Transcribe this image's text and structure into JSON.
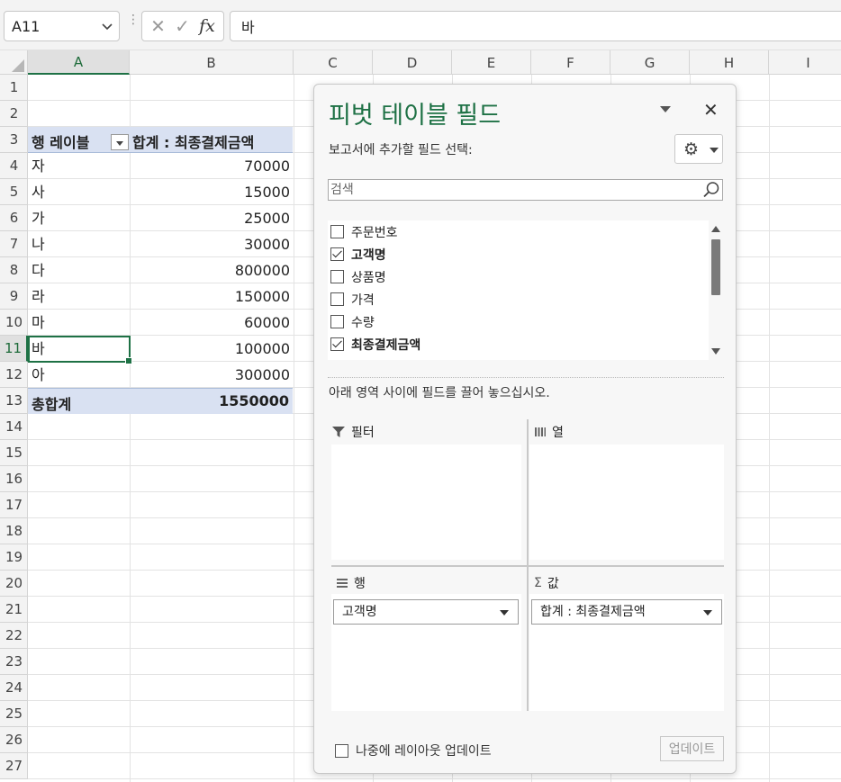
{
  "formula_bar": {
    "name_box": "A11",
    "formula_value": "바",
    "cancel_glyph": "✕",
    "enter_glyph": "✓",
    "fx_label": "fx"
  },
  "columns": [
    "A",
    "B",
    "C",
    "D",
    "E",
    "F",
    "G",
    "H",
    "I"
  ],
  "rows": [
    "1",
    "2",
    "3",
    "4",
    "5",
    "6",
    "7",
    "8",
    "9",
    "10",
    "11",
    "12",
    "13",
    "14",
    "15",
    "16",
    "17",
    "18",
    "19",
    "20",
    "21",
    "22",
    "23",
    "24",
    "25",
    "26",
    "27"
  ],
  "active_cell": {
    "column": "A",
    "row": "11"
  },
  "pivot_table": {
    "row_label_header": "행 레이블",
    "value_header": "합계 : 최종결제금액",
    "items": [
      {
        "label": "자",
        "value": "70000"
      },
      {
        "label": "사",
        "value": "15000"
      },
      {
        "label": "가",
        "value": "25000"
      },
      {
        "label": "나",
        "value": "30000"
      },
      {
        "label": "다",
        "value": "800000"
      },
      {
        "label": "라",
        "value": "150000"
      },
      {
        "label": "마",
        "value": "60000"
      },
      {
        "label": "바",
        "value": "100000"
      },
      {
        "label": "아",
        "value": "300000"
      }
    ],
    "grand_total_label": "총합계",
    "grand_total_value": "1550000"
  },
  "pane": {
    "title": "피벗 테이블 필드",
    "close_glyph": "✕",
    "choose_fields_label": "보고서에 추가할 필드 선택:",
    "gear_glyph": "⚙",
    "search_placeholder": "검색",
    "fields": [
      {
        "label": "주문번호",
        "checked": false
      },
      {
        "label": "고객명",
        "checked": true
      },
      {
        "label": "상품명",
        "checked": false
      },
      {
        "label": "가격",
        "checked": false
      },
      {
        "label": "수량",
        "checked": false
      },
      {
        "label": "최종결제금액",
        "checked": true
      }
    ],
    "drag_label": "아래 영역 사이에 필드를 끌어 놓으십시오.",
    "areas": {
      "filters": {
        "label": "필터",
        "icon": "filter-icon"
      },
      "columns": {
        "label": "열",
        "icon": "columns-icon"
      },
      "rows": {
        "label": "행",
        "icon": "rows-icon",
        "items": [
          "고객명"
        ]
      },
      "values": {
        "label": "값",
        "icon": "sigma-icon",
        "glyph": "Σ",
        "items": [
          "합계 : 최종결제금액"
        ]
      }
    },
    "defer_label": "나중에 레이아웃 업데이트",
    "update_label": "업데이트"
  }
}
